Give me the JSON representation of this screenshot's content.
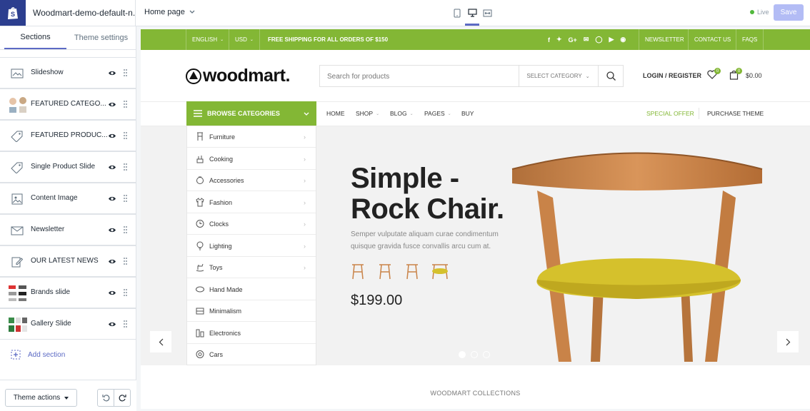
{
  "topbar": {
    "theme_name": "Woodmart-demo-default-n...",
    "page_select": "Home page",
    "live_label": "Live",
    "save_label": "Save",
    "colors": {
      "accent": "#5c6ac4",
      "save_disabled": "#b3bcf5",
      "live": "#50b83c"
    }
  },
  "sidebar": {
    "tabs": [
      "Sections",
      "Theme settings"
    ],
    "sections": [
      {
        "label": "Slideshow",
        "icon": "slideshow-icon"
      },
      {
        "label": "FEATURED CATEGO...",
        "icon": "featured-categories-thumbnail"
      },
      {
        "label": "FEATURED PRODUC...",
        "icon": "tag-icon"
      },
      {
        "label": "Single Product Slide",
        "icon": "tag-icon"
      },
      {
        "label": "Content Image",
        "icon": "image-icon"
      },
      {
        "label": "Newsletter",
        "icon": "mail-icon"
      },
      {
        "label": "OUR LATEST NEWS",
        "icon": "edit-icon"
      },
      {
        "label": "Brands slide",
        "icon": "brands-thumbnail"
      },
      {
        "label": "Gallery Slide",
        "icon": "gallery-thumbnail"
      }
    ],
    "add_section": "Add section",
    "theme_actions": "Theme actions"
  },
  "store": {
    "brand_color": "#83b735",
    "topbar": {
      "language": "ENGLISH",
      "currency": "USD",
      "shipping": "FREE SHIPPING FOR ALL ORDERS OF $150",
      "links": [
        "NEWSLETTER",
        "CONTACT US",
        "FAQS"
      ]
    },
    "logo_text": "woodmart.",
    "search": {
      "placeholder": "Search for products",
      "category": "SELECT CATEGORY"
    },
    "login": "LOGIN / REGISTER",
    "wishlist_count": "0",
    "cart_count": "0",
    "cart_total": "$0.00",
    "browse": "BROWSE CATEGORIES",
    "nav": [
      "HOME",
      "SHOP",
      "BLOG",
      "PAGES",
      "BUY"
    ],
    "special_offer": "SPECIAL OFFER",
    "purchase_theme": "PURCHASE THEME",
    "categories": [
      "Furniture",
      "Cooking",
      "Accessories",
      "Fashion",
      "Clocks",
      "Lighting",
      "Toys",
      "Hand Made",
      "Minimalism",
      "Electronics",
      "Cars"
    ],
    "hero": {
      "title_line1": "Simple -",
      "title_line2": "Rock Chair.",
      "description": "Semper vulputate aliquam curae condimentum quisque gravida fusce convallis arcu cum at.",
      "price": "$199.00"
    },
    "collections_heading": "WOODMART COLLECTIONS"
  }
}
